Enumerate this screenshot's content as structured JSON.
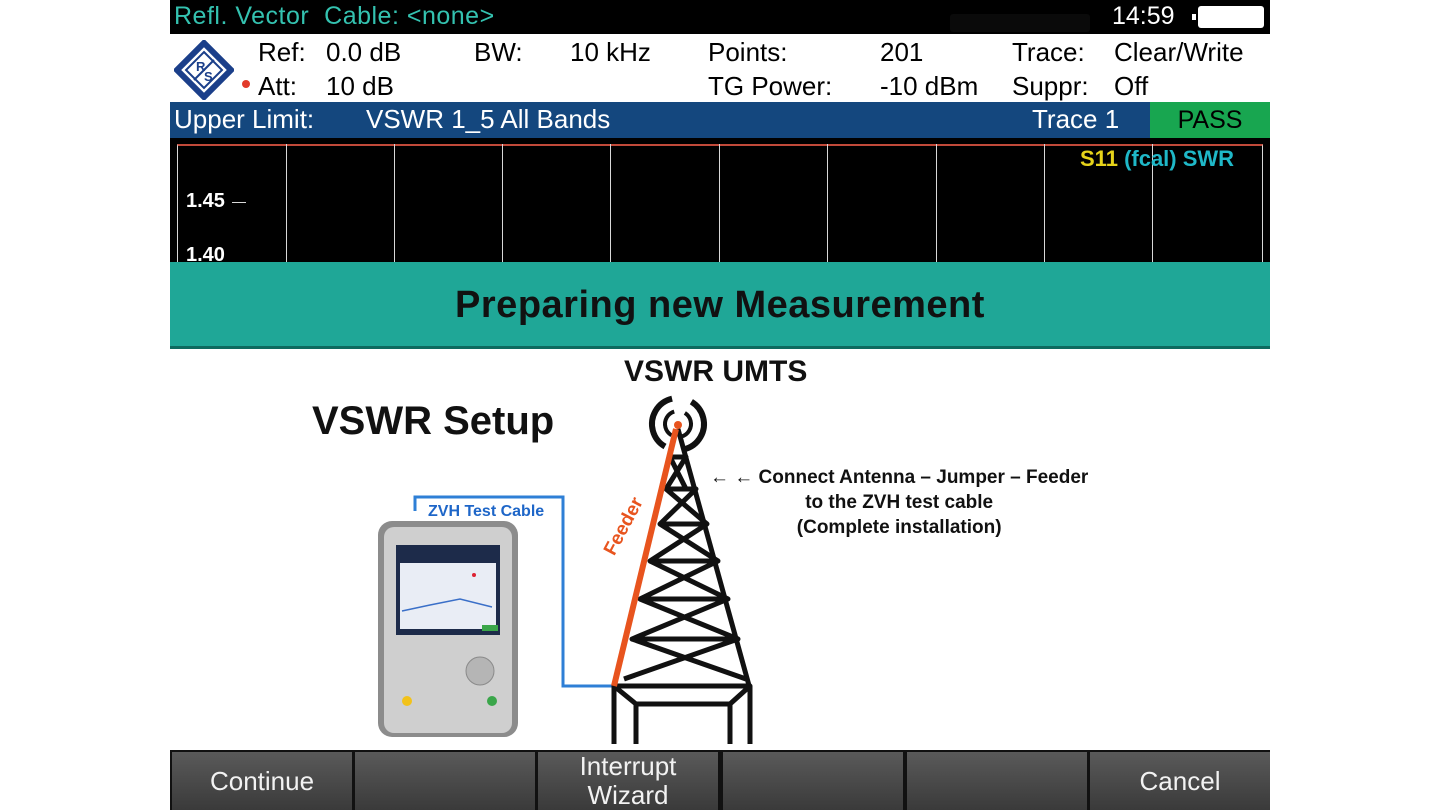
{
  "status_bar": {
    "mode": "Refl. Vector",
    "cable": "Cable: <none>",
    "time": "14:59"
  },
  "params": {
    "ref_label": "Ref:",
    "ref_value": "0.0 dB",
    "att_label": "Att:",
    "att_value": "10 dB",
    "bw_label": "BW:",
    "bw_value": "10 kHz",
    "points_label": "Points:",
    "points_value": "201",
    "tg_label": "TG Power:",
    "tg_value": "-10 dBm",
    "trace_label": "Trace:",
    "trace_value": "Clear/Write",
    "suppr_label": "Suppr:",
    "suppr_value": "Off"
  },
  "limit_bar": {
    "label": "Upper Limit:",
    "value": "VSWR 1_5 All Bands",
    "trace": "Trace 1",
    "result": "PASS"
  },
  "grid": {
    "y_labels": [
      "1.45",
      "1.40"
    ],
    "trace_tag_a": "S11",
    "trace_tag_b": "(fcal) SWR"
  },
  "banner": {
    "text": "Preparing new Measurement"
  },
  "illustration": {
    "title_top": "VSWR UMTS",
    "title_setup": "VSWR Setup",
    "instruction_lines": [
      "← ← Connect Antenna – Jumper – Feeder",
      "to the ZVH test cable",
      "(Complete installation)"
    ],
    "cable_label": "ZVH Test Cable",
    "feeder_label": "Feeder"
  },
  "softkeys": [
    "Continue",
    "",
    "Interrupt Wizard",
    "",
    "",
    "Cancel"
  ],
  "colors": {
    "mode_text": "#34c2b0",
    "limit_bar": "#14477e",
    "pass": "#18a650",
    "banner": "#1fa797",
    "feeder": "#e8541e",
    "cable": "#1e66c8"
  }
}
